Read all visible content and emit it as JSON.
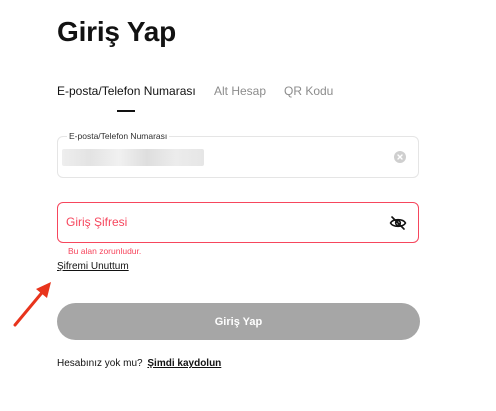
{
  "page": {
    "title": "Giriş Yap"
  },
  "tabs": [
    {
      "label": "E-posta/Telefon Numarası",
      "active": true
    },
    {
      "label": "Alt Hesap",
      "active": false
    },
    {
      "label": "QR Kodu",
      "active": false
    }
  ],
  "email_field": {
    "label": "E-posta/Telefon Numarası",
    "value_state": "blurred",
    "clear_icon": "clear-circle-x-icon"
  },
  "password_field": {
    "placeholder": "Giriş Şifresi",
    "value": "",
    "toggle_icon": "eye-slash-icon",
    "error": "Bu alan zorunludur."
  },
  "forgot_password": {
    "label": "Şifremi Unuttum"
  },
  "submit": {
    "label": "Giriş Yap"
  },
  "signup": {
    "prompt": "Hesabınız yok mu?",
    "link": "Şimdi kaydolun"
  },
  "colors": {
    "text": "#121212",
    "muted": "#8c8c8c",
    "error": "#f6465d",
    "button_disabled": "#a6a6a6",
    "border": "#e5e5e5",
    "annotation_arrow": "#e8341c"
  }
}
